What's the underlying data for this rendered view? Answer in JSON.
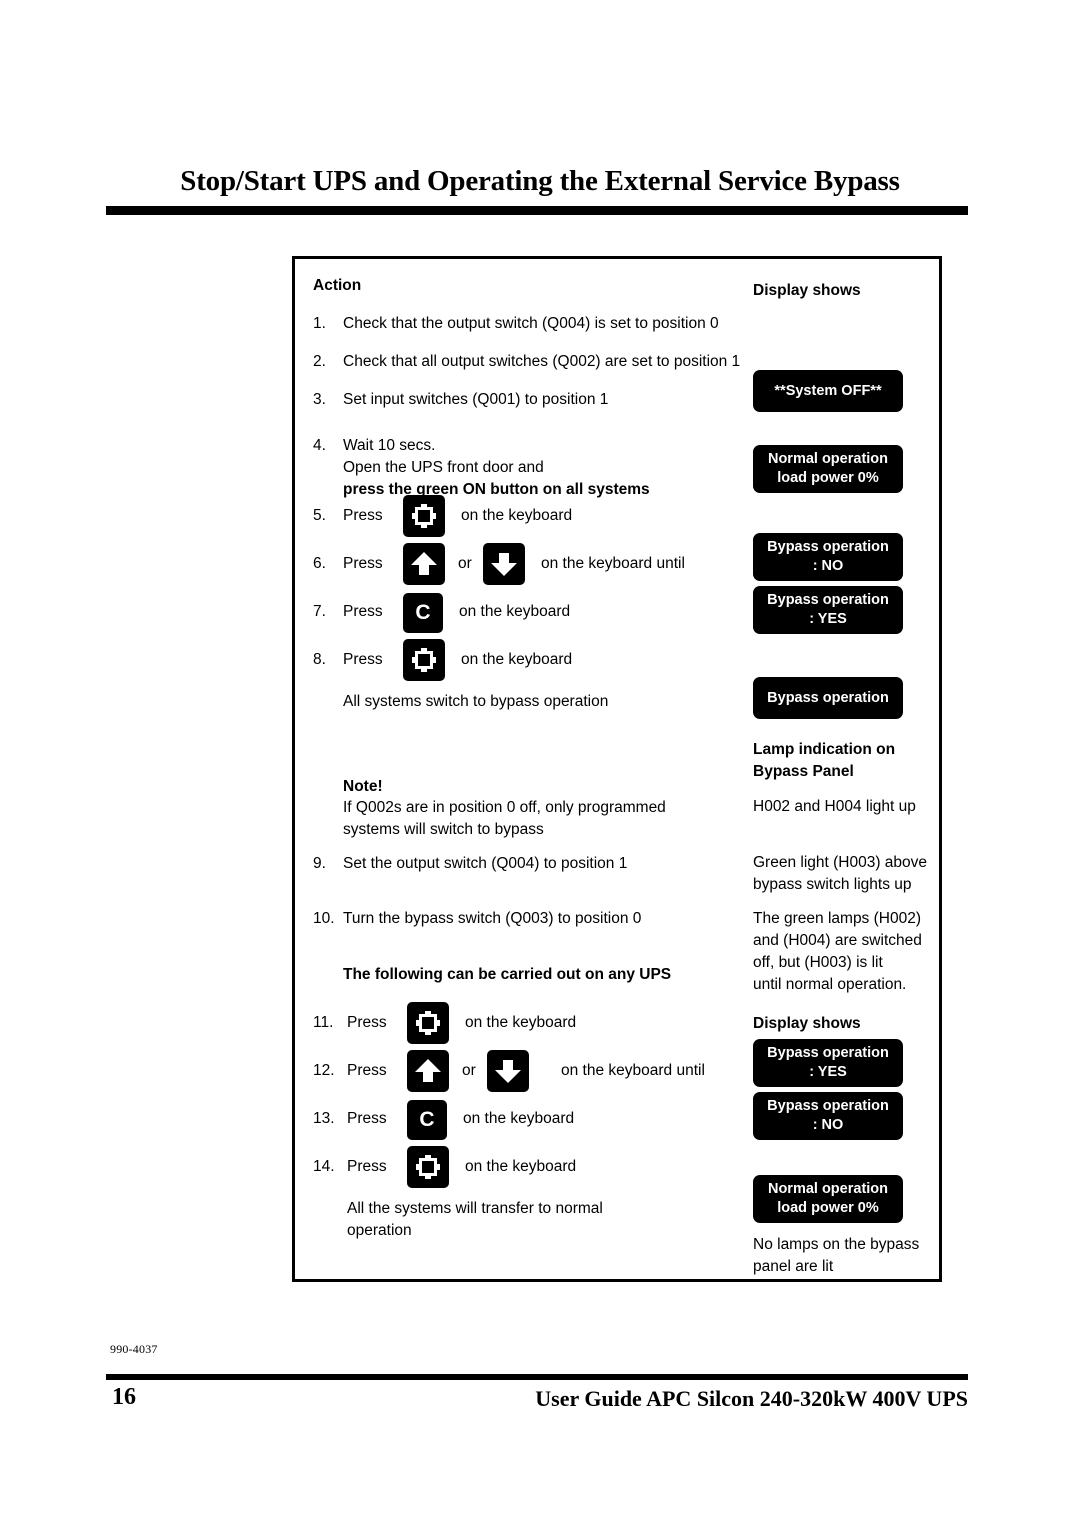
{
  "page": {
    "title": "Stop/Start UPS and Operating the External Service Bypass",
    "doc_code": "990-4037",
    "page_number": "16",
    "footer_title": "User Guide APC Silcon 240-320kW 400V UPS"
  },
  "table": {
    "action_header": "Action",
    "display_header": "Display shows",
    "display_header_2": "Display shows",
    "lamp_header_line1": "Lamp indication on",
    "lamp_header_line2": "Bypass Panel",
    "steps": [
      {
        "num": "1.",
        "text": "Check that the output switch (Q004) is set to position 0"
      },
      {
        "num": "2.",
        "text": "Check that all output switches (Q002) are set to position 1"
      },
      {
        "num": "3.",
        "text": "Set input switches (Q001) to position 1"
      },
      {
        "num": "4.",
        "line1": "Wait 10 secs.",
        "line2": "Open the UPS front door and",
        "line3": "press the green ON button on all systems"
      },
      {
        "num": "5.",
        "press": "Press",
        "icon": "frame-key-icon",
        "after": "on the keyboard"
      },
      {
        "num": "6.",
        "press": "Press",
        "icon": "up-arrow-key-icon",
        "mid": "or",
        "icon2": "down-arrow-key-icon",
        "after": "on the keyboard until"
      },
      {
        "num": "7.",
        "press": "Press",
        "icon": "c-key-icon",
        "after": "on the keyboard"
      },
      {
        "num": "8.",
        "press": "Press",
        "icon": "frame-key-icon",
        "after": "on the keyboard"
      },
      {
        "num": "9.",
        "text": "Set the output switch (Q004) to position 1"
      },
      {
        "num": "10.",
        "text": "Turn the bypass switch (Q003) to position 0"
      },
      {
        "num": "11.",
        "press": "Press",
        "icon": "frame-key-icon",
        "after": "on the keyboard"
      },
      {
        "num": "12.",
        "press": "Press",
        "icon": "up-arrow-key-icon",
        "mid": "or",
        "icon2": "down-arrow-key-icon",
        "after": "on the keyboard until"
      },
      {
        "num": "13.",
        "press": "Press",
        "icon": "c-key-icon",
        "after": "on the keyboard"
      },
      {
        "num": "14.",
        "press": "Press",
        "icon": "frame-key-icon",
        "after": "on the keyboard"
      }
    ],
    "note_bypass": "All systems switch to bypass operation",
    "note_heading": "Note!",
    "note_line1": "If Q002s are in position 0 off, only programmed",
    "note_line2": "systems will switch to bypass",
    "any_ups_heading": "The following can be carried out on any UPS",
    "final_line1": "All the systems will transfer to normal",
    "final_line2": "operation",
    "key_letter_c": "C",
    "displays": {
      "system_off": "**System OFF**",
      "normal_op_1_l1": "Normal operation",
      "normal_op_1_l2": "load power 0%",
      "bypass_no_1_l1": "Bypass operation",
      "bypass_no_1_l2": ": NO",
      "bypass_yes_1_l1": "Bypass operation",
      "bypass_yes_1_l2": ": YES",
      "bypass_op_single": "Bypass operation",
      "bypass_yes_2_l1": "Bypass operation",
      "bypass_yes_2_l2": ": YES",
      "bypass_no_2_l1": "Bypass operation",
      "bypass_no_2_l2": ": NO",
      "normal_op_2_l1": "Normal operation",
      "normal_op_2_l2": "load power 0%"
    },
    "lamps": {
      "h002_h004": "H002 and H004 light up",
      "green_l1": "Green light (H003) above",
      "green_l2": "bypass switch lights up",
      "off_l1": "The green lamps (H002)",
      "off_l2": "and (H004) are switched",
      "off_l3": "off, but (H003) is lit",
      "off_l4": "until normal operation.",
      "none_l1": "No lamps on the bypass",
      "none_l2": "panel are lit"
    }
  },
  "colors": {
    "ink": "#000000",
    "paper": "#ffffff",
    "lcd_bg": "#000000",
    "lcd_text": "#ffffff"
  }
}
